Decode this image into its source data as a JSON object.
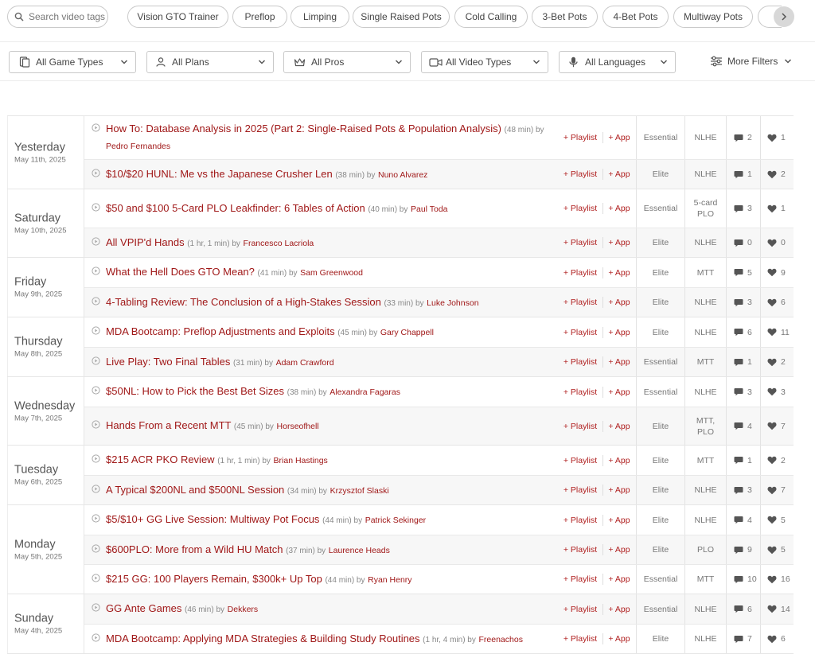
{
  "search": {
    "placeholder": "Search video tags"
  },
  "tags": [
    "Vision GTO Trainer",
    "Preflop",
    "Limping",
    "Single Raised Pots",
    "Cold Calling",
    "3-Bet Pots",
    "4-Bet Pots",
    "Multiway Pots"
  ],
  "filters": {
    "game_types": "All Game Types",
    "plans": "All Plans",
    "pros": "All Pros",
    "video_types": "All Video Types",
    "languages": "All Languages",
    "more": "More Filters"
  },
  "actions": {
    "playlist": "+ Playlist",
    "app": "+ App"
  },
  "colors": {
    "title": "#a01818",
    "action": "#b02020",
    "nav_button": "#d8d8d8"
  },
  "days": [
    {
      "day": "Yesterday",
      "date": "May 11th, 2025",
      "videos": [
        {
          "title": "How To: Database Analysis in 2025 (Part 2: Single-Raised Pots & Population Analysis)",
          "duration": "(48 min) by",
          "author": "Pedro Fernandes",
          "plan": "Essential",
          "game": "NLHE",
          "comments": "2",
          "likes": "1"
        },
        {
          "title": "$10/$20 HUNL: Me vs the Japanese Crusher Len",
          "duration": "(38 min) by",
          "author": "Nuno Alvarez",
          "plan": "Elite",
          "game": "NLHE",
          "comments": "1",
          "likes": "2"
        }
      ]
    },
    {
      "day": "Saturday",
      "date": "May 10th, 2025",
      "videos": [
        {
          "title": "$50 and $100 5-Card PLO Leakfinder: 6 Tables of Action",
          "duration": "(40 min) by",
          "author": "Paul Toda",
          "plan": "Essential",
          "game": "5-card PLO",
          "comments": "3",
          "likes": "1"
        },
        {
          "title": "All VPIP'd Hands",
          "duration": "(1 hr, 1 min) by",
          "author": "Francesco Lacriola",
          "plan": "Elite",
          "game": "NLHE",
          "comments": "0",
          "likes": "0"
        }
      ]
    },
    {
      "day": "Friday",
      "date": "May 9th, 2025",
      "videos": [
        {
          "title": "What the Hell Does GTO Mean?",
          "duration": "(41 min) by",
          "author": "Sam Greenwood",
          "plan": "Elite",
          "game": "MTT",
          "comments": "5",
          "likes": "9"
        },
        {
          "title": "4-Tabling Review: The Conclusion of a High-Stakes Session",
          "duration": "(33 min) by",
          "author": "Luke Johnson",
          "plan": "Elite",
          "game": "NLHE",
          "comments": "3",
          "likes": "6"
        }
      ]
    },
    {
      "day": "Thursday",
      "date": "May 8th, 2025",
      "videos": [
        {
          "title": "MDA Bootcamp: Preflop Adjustments and Exploits",
          "duration": "(45 min) by",
          "author": "Gary Chappell",
          "plan": "Elite",
          "game": "NLHE",
          "comments": "6",
          "likes": "11"
        },
        {
          "title": "Live Play: Two Final Tables",
          "duration": "(31 min) by",
          "author": "Adam Crawford",
          "plan": "Essential",
          "game": "MTT",
          "comments": "1",
          "likes": "2"
        }
      ]
    },
    {
      "day": "Wednesday",
      "date": "May 7th, 2025",
      "videos": [
        {
          "title": "$50NL: How to Pick the Best Bet Sizes",
          "duration": "(38 min) by",
          "author": "Alexandra Fagaras",
          "plan": "Essential",
          "game": "NLHE",
          "comments": "3",
          "likes": "3"
        },
        {
          "title": "Hands From a Recent MTT",
          "duration": "(45 min) by",
          "author": "Horseofhell",
          "plan": "Elite",
          "game": "MTT, PLO",
          "comments": "4",
          "likes": "7"
        }
      ]
    },
    {
      "day": "Tuesday",
      "date": "May 6th, 2025",
      "videos": [
        {
          "title": "$215 ACR PKO Review",
          "duration": "(1 hr, 1 min) by",
          "author": "Brian Hastings",
          "plan": "Elite",
          "game": "MTT",
          "comments": "1",
          "likes": "2"
        },
        {
          "title": "A Typical $200NL and $500NL Session",
          "duration": "(34 min) by",
          "author": "Krzysztof Slaski",
          "plan": "Elite",
          "game": "NLHE",
          "comments": "3",
          "likes": "7"
        }
      ]
    },
    {
      "day": "Monday",
      "date": "May 5th, 2025",
      "videos": [
        {
          "title": "$5/$10+ GG Live Session: Multiway Pot Focus",
          "duration": "(44 min) by",
          "author": "Patrick Sekinger",
          "plan": "Elite",
          "game": "NLHE",
          "comments": "4",
          "likes": "5"
        },
        {
          "title": "$600PLO: More from a Wild HU Match",
          "duration": "(37 min) by",
          "author": "Laurence Heads",
          "plan": "Elite",
          "game": "PLO",
          "comments": "9",
          "likes": "5"
        },
        {
          "title": "$215 GG: 100 Players Remain, $300k+ Up Top",
          "duration": "(44 min) by",
          "author": "Ryan Henry",
          "plan": "Essential",
          "game": "MTT",
          "comments": "10",
          "likes": "16"
        }
      ]
    },
    {
      "day": "Sunday",
      "date": "May 4th, 2025",
      "videos": [
        {
          "title": "GG Ante Games",
          "duration": "(46 min) by",
          "author": "Dekkers",
          "plan": "Essential",
          "game": "NLHE",
          "comments": "6",
          "likes": "14"
        },
        {
          "title": "MDA Bootcamp: Applying MDA Strategies & Building Study Routines",
          "duration": "(1 hr, 4 min) by",
          "author": "Freenachos",
          "plan": "Elite",
          "game": "NLHE",
          "comments": "7",
          "likes": "6"
        }
      ]
    }
  ]
}
